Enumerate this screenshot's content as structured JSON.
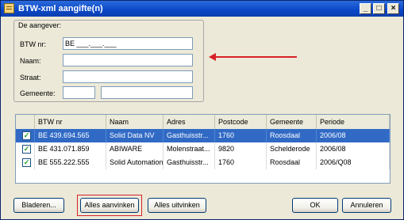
{
  "window": {
    "title": "BTW-xml aangifte(n)",
    "controls": {
      "minimize": "_",
      "maximize": "□",
      "close": "×"
    }
  },
  "declarant": {
    "group_label": "De aangever:",
    "btw_label": "BTW nr:",
    "btw_value": "BE ___.___.___",
    "naam_label": "Naam:",
    "naam_value": "",
    "straat_label": "Straat:",
    "straat_value": "",
    "gemeente_label": "Gemeente:",
    "gemeente_postcode_value": "",
    "gemeente_value": ""
  },
  "list": {
    "columns": [
      "BTW nr",
      "Naam",
      "Adres",
      "Postcode",
      "Gemeente",
      "Periode"
    ],
    "rows": [
      {
        "checked": true,
        "selected": true,
        "cells": [
          "BE 439.694.565",
          "Solid Data NV",
          "Gasthuisstr...",
          "1760",
          "Roosdaal",
          "2006/08"
        ]
      },
      {
        "checked": true,
        "selected": false,
        "cells": [
          "BE 431.071.859",
          "ABIWARE",
          "Molenstraat...",
          "9820",
          "Schelderode",
          "2006/08"
        ]
      },
      {
        "checked": true,
        "selected": false,
        "cells": [
          "BE 555.222.555",
          "Solid Automation",
          "Gasthuisstr...",
          "1760",
          "Roosdaal",
          "2006/Q08"
        ]
      }
    ]
  },
  "buttons": {
    "browse": "Bladeren...",
    "check_all": "Alles aanvinken",
    "uncheck_all": "Alles uitvinken",
    "ok": "OK",
    "cancel": "Annuleren"
  },
  "colors": {
    "title_bar": "#0a47c7",
    "selection": "#316ac5",
    "annotation": "#d7222a",
    "check": "#21a121"
  },
  "icons": {
    "app": "document-icon",
    "checkmark": "checkmark-icon",
    "annotation": "arrow-left-icon"
  }
}
